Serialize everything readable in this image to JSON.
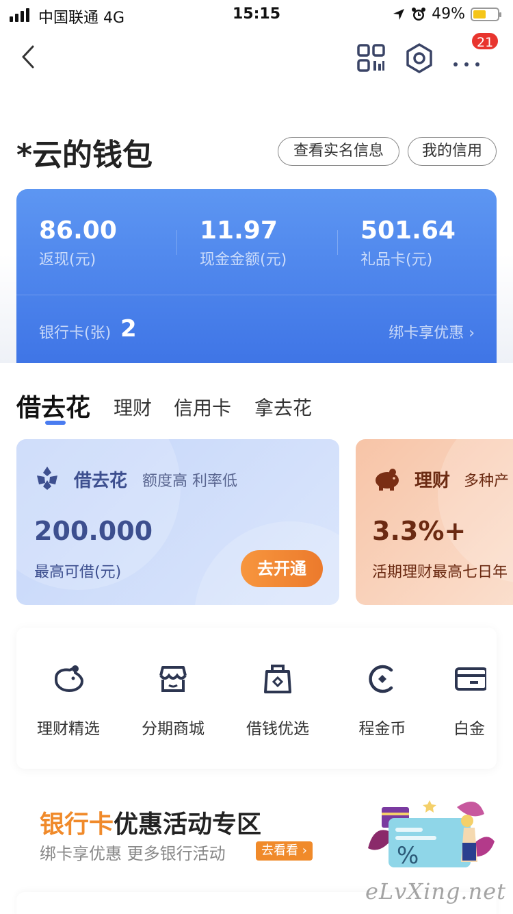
{
  "status_bar": {
    "carrier": "中国联通  4G",
    "time": "15:15",
    "battery": "49%"
  },
  "nav": {
    "badge_count": "21"
  },
  "wallet": {
    "title": "*云的钱包",
    "view_realname_label": "查看实名信息",
    "my_credit_label": "我的信用"
  },
  "balance": {
    "items": [
      {
        "value": "86.00",
        "label": "返现(元)"
      },
      {
        "value": "11.97",
        "label": "现金金额(元)"
      },
      {
        "value": "501.64",
        "label": "礼品卡(元)"
      }
    ],
    "bank_card_label": "银行卡(张)",
    "bank_card_count": "2",
    "bind_card_link": "绑卡享优惠 ›"
  },
  "tabs": [
    "借去花",
    "理财",
    "信用卡",
    "拿去花"
  ],
  "products": [
    {
      "name": "借去花",
      "subtitle": "额度高 利率低",
      "value": "200.000",
      "desc": "最高可借(元)",
      "button": "去开通",
      "accent": "#3d4f8f"
    },
    {
      "name": "理财",
      "subtitle": "多种产",
      "value": "3.3%+",
      "desc": "活期理财最高七日年",
      "accent": "#6b2a12"
    }
  ],
  "menu": [
    {
      "label": "理财精选",
      "icon": "piggy-bank-icon"
    },
    {
      "label": "分期商城",
      "icon": "shop-icon"
    },
    {
      "label": "借钱优选",
      "icon": "money-bag-icon"
    },
    {
      "label": "程金币",
      "icon": "coin-icon"
    },
    {
      "label": "白金",
      "icon": "card-icon"
    }
  ],
  "banner": {
    "title_highlight": "银行卡",
    "title_rest": "优惠活动专区",
    "subtitle": "绑卡享优惠 更多银行活动",
    "button": "去看看 ›"
  },
  "watermark": "eLvXing.net",
  "colors": {
    "primary_blue": "#4a7cf0",
    "orange": "#f08a2a",
    "badge_red": "#e8352e"
  }
}
